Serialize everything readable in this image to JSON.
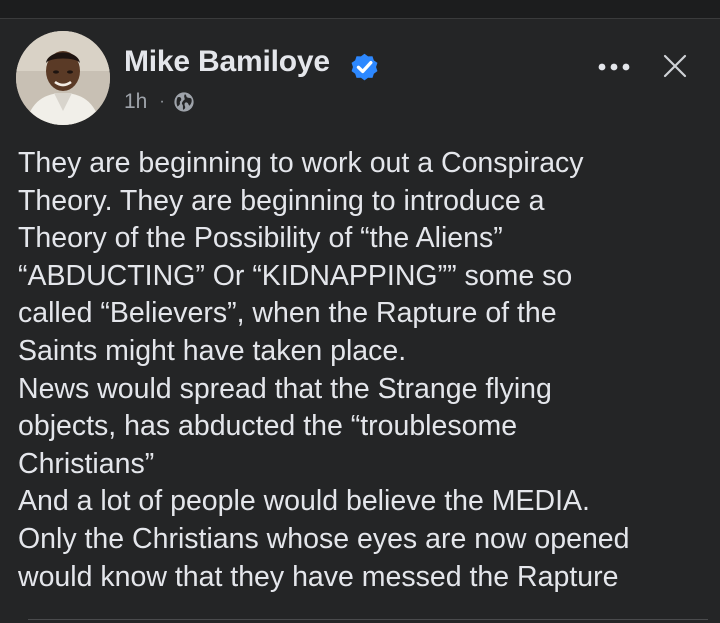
{
  "post": {
    "author": "Mike Bamiloye",
    "verified_icon": "verified-badge-icon",
    "time": "1h",
    "separator": "·",
    "audience_icon": "globe-icon",
    "more_icon": "more-options-icon",
    "close_icon": "close-icon",
    "paragraphs": [
      "They are beginning to work out a Conspiracy\nTheory. They are beginning to introduce a\nTheory of the Possibility of “the Aliens”\n“ABDUCTING” Or “KIDNAPPING”” some so\ncalled “Believers”, when the Rapture of the\nSaints might have taken place.",
      "News would spread that the Strange flying\nobjects, has abducted the “troublesome\nChristians”",
      "And a lot of people would believe the MEDIA.",
      "Only the Christians whose eyes are now opened\nwould know that they have messed the Rapture"
    ]
  },
  "colors": {
    "background": "#242526",
    "text_primary": "#e4e6eb",
    "text_secondary": "#9ea3aa",
    "verified_blue": "#2d88ff"
  }
}
